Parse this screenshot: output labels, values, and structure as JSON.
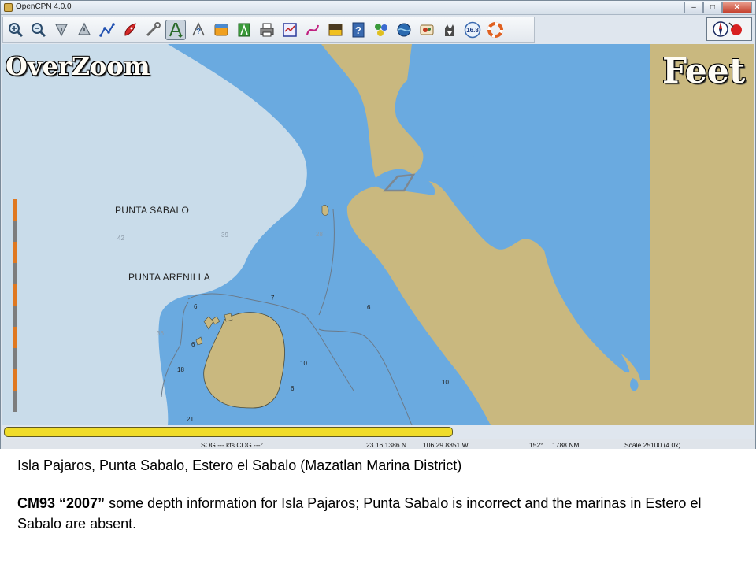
{
  "window": {
    "title": "OpenCPN 4.0.0",
    "controls": {
      "minimize": "–",
      "maximize": "□",
      "close": "✕"
    }
  },
  "toolbar": {
    "buttons": [
      {
        "name": "zoom-in-icon"
      },
      {
        "name": "zoom-out-icon"
      },
      {
        "name": "scale-in-icon"
      },
      {
        "name": "scale-out-icon"
      },
      {
        "name": "route-icon"
      },
      {
        "name": "auto-follow-icon"
      },
      {
        "name": "settings-icon"
      },
      {
        "name": "text-toggle-icon",
        "active": true
      },
      {
        "name": "current-tide-icon"
      },
      {
        "name": "route-manager-icon"
      },
      {
        "name": "track-icon"
      },
      {
        "name": "print-icon"
      },
      {
        "name": "color-scheme-icon"
      },
      {
        "name": "mob-icon"
      },
      {
        "name": "cm93-zoom-icon"
      },
      {
        "name": "help-icon"
      },
      {
        "name": "ais-icon"
      },
      {
        "name": "globe-icon"
      },
      {
        "name": "nav-object-icon"
      },
      {
        "name": "dog-icon"
      },
      {
        "name": "speed-icon",
        "text": "16.8"
      },
      {
        "name": "lifebuoy-icon"
      }
    ]
  },
  "chart": {
    "overzoom_label": "OverZoom",
    "units_label": "Feet",
    "place_labels": [
      {
        "key": "punta_sabalo",
        "text": "PUNTA SABALO"
      },
      {
        "key": "punta_arenilla",
        "text": "PUNTA ARENILLA"
      }
    ],
    "soundings": [
      "42",
      "39",
      "28",
      "7",
      "6",
      "6",
      "6",
      "36",
      "18",
      "10",
      "6",
      "10",
      "21"
    ],
    "colors": {
      "land": "#c9b87f",
      "shallow_water": "#6aaae0",
      "deep_water": "#c9dcea",
      "scale_bar": "#e07820"
    }
  },
  "progress": {
    "value_percent": 100,
    "color": "#f0dc2a"
  },
  "status": {
    "sog_cog": "SOG --- kts COG ---°",
    "latitude": "23 16.1386 N",
    "longitude": "106 29.8351 W",
    "bearing": "152°",
    "distance": "1788 NMi",
    "scale": "Scale 25100 (4.0x)"
  },
  "caption": {
    "line1": "Isla Pajaros, Punta Sabalo, Estero el Sabalo (Mazatlan Marina District)",
    "line2_bold": "CM93 “2007”",
    "line2_rest": " some depth information for Isla Pajaros; Punta Sabalo is incorrect and the marinas in Estero el Sabalo  are absent."
  }
}
